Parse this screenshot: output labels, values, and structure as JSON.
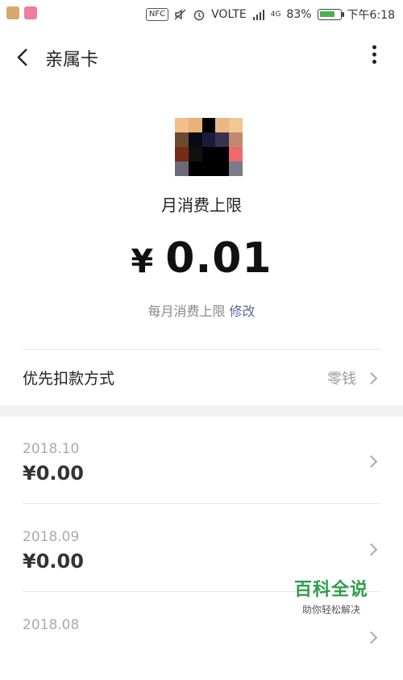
{
  "status_bar": {
    "nfc": "NFC",
    "volte": "VOLTE",
    "network": "4G",
    "battery": "83%",
    "battery_level": 0.83,
    "time": "下午6:18",
    "app_icon_colors": [
      "#d7a96a",
      "#f07aa0"
    ]
  },
  "header": {
    "title": "亲属卡"
  },
  "card": {
    "limit_label": "月消费上限",
    "currency": "¥",
    "amount": "0.01",
    "sublimit_text": "每月消费上限",
    "modify_link": "修改"
  },
  "payment": {
    "label": "优先扣款方式",
    "value": "零钱"
  },
  "months": [
    {
      "date": "2018.10",
      "amount": "¥0.00"
    },
    {
      "date": "2018.09",
      "amount": "¥0.00"
    },
    {
      "date": "2018.08",
      "amount": ""
    }
  ],
  "watermark": {
    "title": "百科全说",
    "subtitle": "助你轻松解决"
  },
  "colors": {
    "link": "#576b95",
    "watermark": "#2f9e49",
    "battery_fill": "#4caf50",
    "avatar_pixels": [
      "#f0c08a",
      "#e8b07a",
      "#000000",
      "#e8b880",
      "#f0c890",
      "#6b4a2e",
      "#0a0a14",
      "#1a1a3a",
      "#3a3050",
      "#c08a70",
      "#7a2a1a",
      "#111111",
      "#000000",
      "#000000",
      "#ee6a6a",
      "#6a6a7a",
      "#000000",
      "#000000",
      "#000000",
      "#7a7a8a"
    ]
  }
}
